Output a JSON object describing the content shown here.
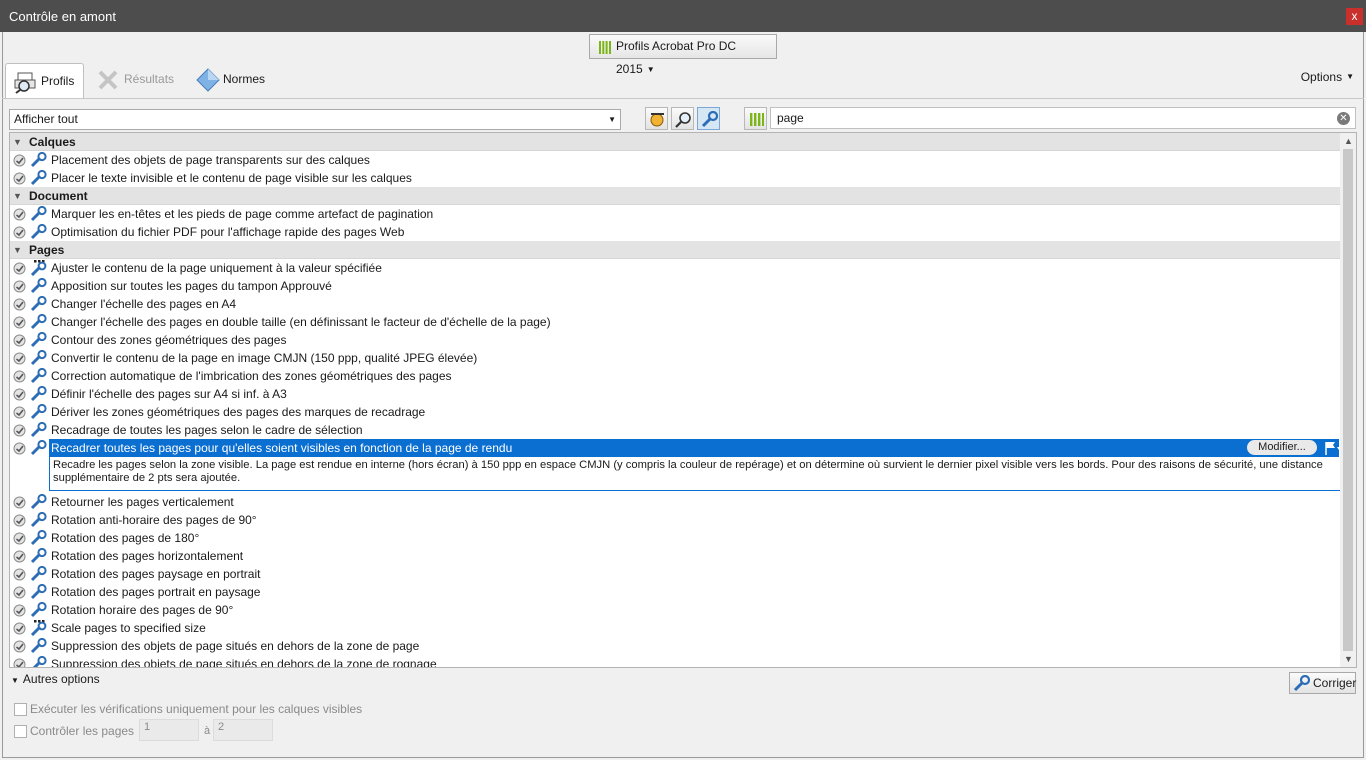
{
  "window": {
    "title": "Contrôle en amont",
    "close_label": "x"
  },
  "profile_selector": {
    "label": "Profils Acrobat Pro DC 2015"
  },
  "tabs": [
    {
      "label": "Profils",
      "state": "active"
    },
    {
      "label": "Résultats",
      "state": "disabled"
    },
    {
      "label": "Normes",
      "state": "normal"
    }
  ],
  "options_label": "Options",
  "filter": {
    "selected": "Afficher tout"
  },
  "search": {
    "value": "page"
  },
  "groups": [
    {
      "name": "Calques",
      "items": [
        "Placement des objets de page transparents sur des calques",
        "Placer le texte invisible et le contenu de page visible sur les calques"
      ]
    },
    {
      "name": "Document",
      "items": [
        "Marquer les en-têtes et les pieds de page comme artefact de pagination",
        "Optimisation du fichier PDF pour l'affichage rapide des pages Web"
      ]
    },
    {
      "name": "Pages",
      "items": [
        "Ajuster le contenu de la page uniquement à la valeur spécifiée",
        "Apposition sur toutes les pages du tampon Approuvé",
        "Changer l'échelle des pages en A4",
        "Changer l'échelle des pages en double taille (en définissant le facteur de d'échelle de la page)",
        "Contour des zones géométriques des pages",
        "Convertir le contenu de la page en image CMJN (150 ppp, qualité JPEG élevée)",
        "Correction automatique de l'imbrication des zones géométriques des pages",
        "Définir l'échelle des pages sur A4 si inf. à A3",
        "Dériver les zones géométriques des pages des marques de recadrage",
        "Recadrage de toutes les pages selon le cadre de sélection",
        "Recadrer toutes les pages pour qu'elles soient visibles en fonction de la page de rendu",
        "Retourner les pages verticalement",
        "Rotation anti-horaire des pages de 90°",
        "Rotation des pages de 180°",
        "Rotation des pages horizontalement",
        "Rotation des pages paysage en portrait",
        "Rotation des pages portrait en paysage",
        "Rotation horaire des pages de 90°",
        "Scale pages to specified size",
        "Suppression des objets de page situés en dehors de la zone de page",
        "Suppression des objets de page situés en dehors de la zone de rognage"
      ]
    }
  ],
  "selected_item": {
    "label": "Recadrer toutes les pages pour qu'elles soient visibles en fonction de la page de rendu",
    "modify_label": "Modifier...",
    "description": "Recadre les pages selon la zone visible. La page est rendue en interne (hors écran) à 150 ppp en espace CMJN (y compris la couleur de repérage) et on détermine où survient le dernier pixel visible vers les bords. Pour des raisons de sécurité, une distance supplémentaire de 2 pts sera ajoutée."
  },
  "special_icon_items": [
    "Ajuster le contenu de la page uniquement à la valeur spécifiée",
    "Scale pages to specified size"
  ],
  "bottom": {
    "autres_options": "Autres options",
    "fix_label": "Corriger",
    "visible_layers_label": "Exécuter les vérifications uniquement pour les calques visibles",
    "check_pages_label": "Contrôler les pages",
    "page_from": "1",
    "to_label": "à",
    "page_to": "2"
  },
  "colors": {
    "selection": "#0a6fd1",
    "titlebar": "#4d4d4d",
    "close": "#c9302c",
    "group_header": "#e3e3e3"
  }
}
